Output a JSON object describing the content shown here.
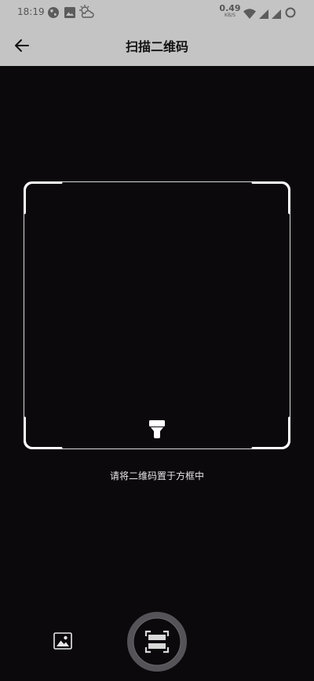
{
  "status_bar": {
    "time": "18:19",
    "left_icons": [
      "globe-icon",
      "image-icon",
      "weather-icon"
    ],
    "net_speed_value": "0.49",
    "net_speed_unit": "KB/S",
    "right_icons": [
      "wifi-icon",
      "signal-icon",
      "signal-icon",
      "circle-icon"
    ]
  },
  "app_bar": {
    "back_icon": "arrow-left-icon",
    "title": "扫描二维码"
  },
  "scanner": {
    "hint": "请将二维码置于方框中",
    "flash_icon": "flashlight-icon"
  },
  "controls": {
    "gallery_icon": "image-icon",
    "scan_icon": "scan-icon"
  },
  "colors": {
    "background": "#0c090d",
    "bar": "#c4c4c4",
    "frame": "#ffffff"
  }
}
